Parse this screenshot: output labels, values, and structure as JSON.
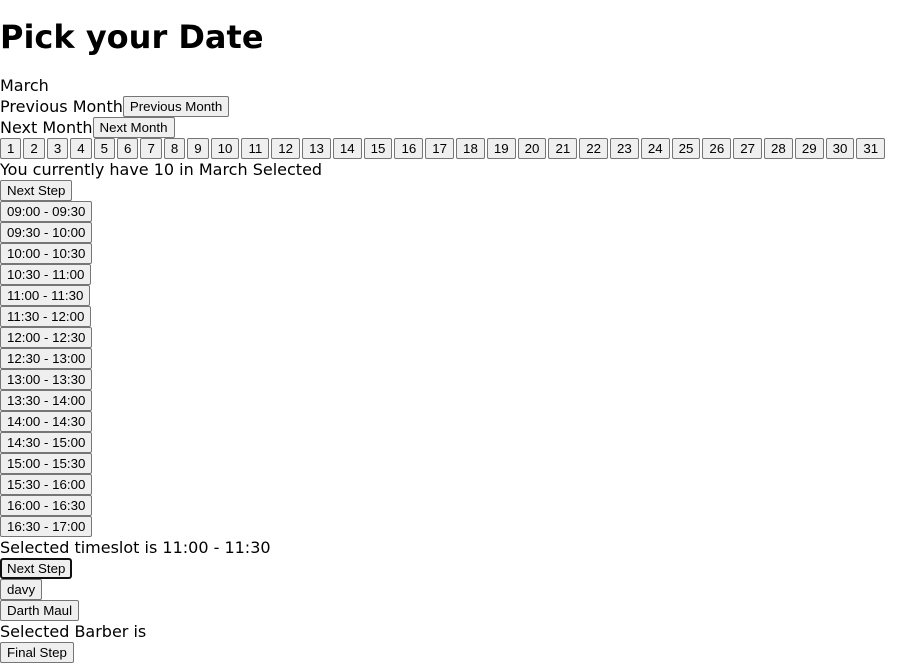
{
  "page": {
    "title": "Pick your Date"
  },
  "month": {
    "name": "March",
    "prev_label_text": "Previous Month",
    "prev_button": "Previous Month",
    "next_label_text": "Next Month",
    "next_button": "Next Month",
    "days": [
      "1",
      "2",
      "3",
      "4",
      "5",
      "6",
      "7",
      "8",
      "9",
      "10",
      "11",
      "12",
      "13",
      "14",
      "15",
      "16",
      "17",
      "18",
      "19",
      "20",
      "21",
      "22",
      "23",
      "24",
      "25",
      "26",
      "27",
      "28",
      "29",
      "30",
      "31"
    ],
    "selected_text": "You currently have 10 in March Selected",
    "next_step": "Next Step"
  },
  "timeslots": {
    "slots": [
      "09:00 - 09:30",
      "09:30 - 10:00",
      "10:00 - 10:30",
      "10:30 - 11:00",
      "11:00 - 11:30",
      "11:30 - 12:00",
      "12:00 - 12:30",
      "12:30 - 13:00",
      "13:00 - 13:30",
      "13:30 - 14:00",
      "14:00 - 14:30",
      "14:30 - 15:00",
      "15:00 - 15:30",
      "15:30 - 16:00",
      "16:00 - 16:30",
      "16:30 - 17:00"
    ],
    "selected_text": "Selected timeslot is 11:00 - 11:30",
    "next_step": "Next Step"
  },
  "barbers": {
    "options": [
      "davy",
      "Darth Maul"
    ],
    "selected_text": "Selected Barber is",
    "final_step": "Final Step"
  }
}
